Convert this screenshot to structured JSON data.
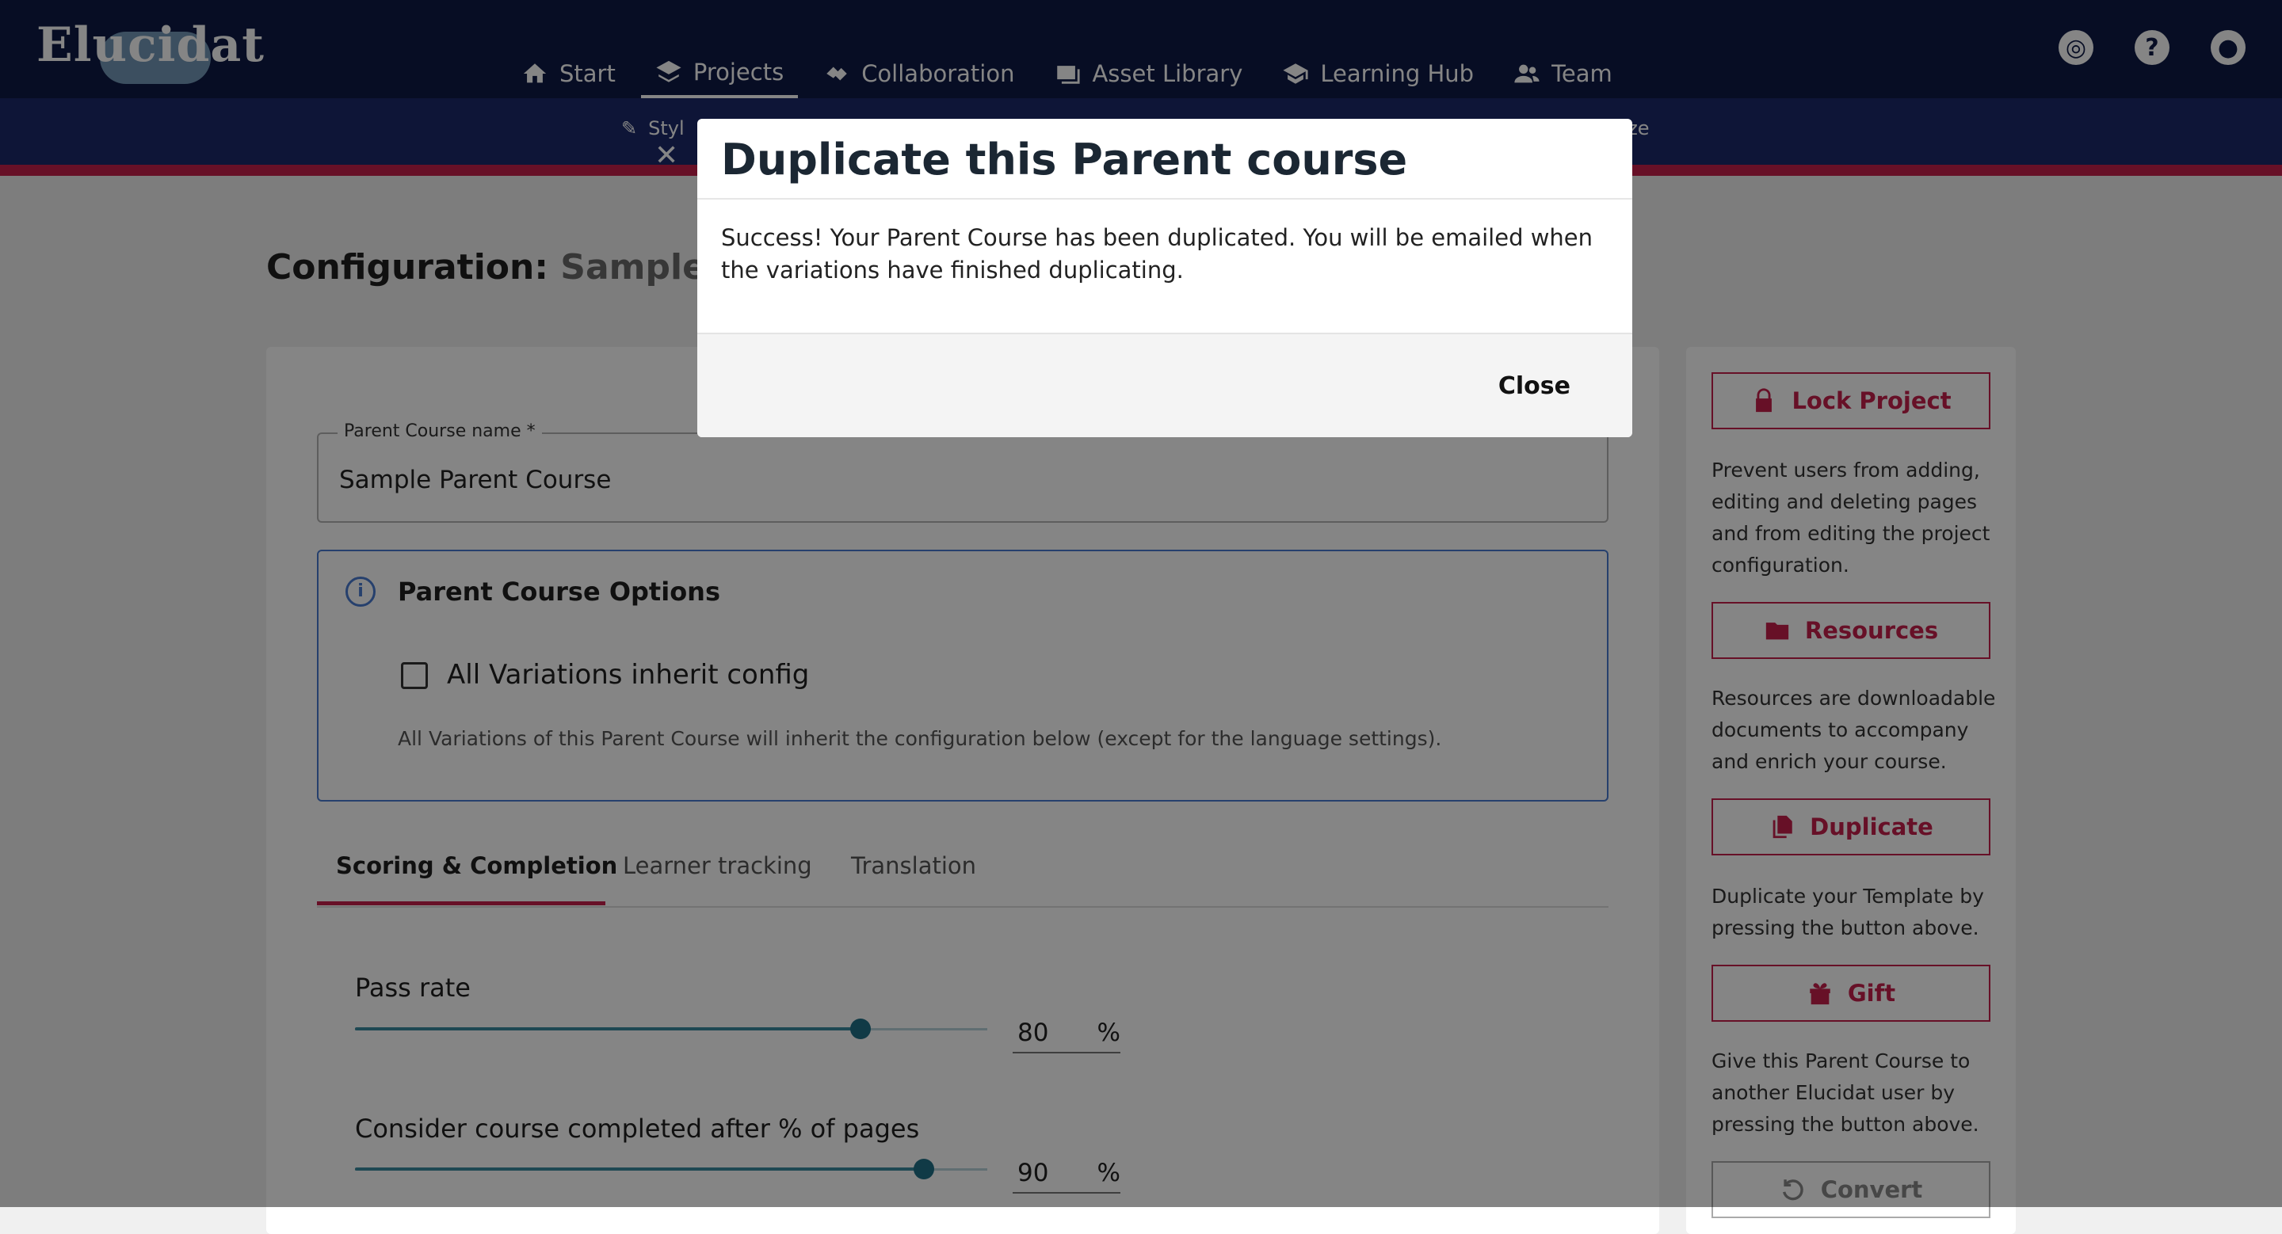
{
  "app": {
    "logo_text": "Elucidat"
  },
  "nav": {
    "items": [
      {
        "label": "Start",
        "icon": "home-icon"
      },
      {
        "label": "Projects",
        "icon": "layers-icon",
        "active": true
      },
      {
        "label": "Collaboration",
        "icon": "handshake-icon"
      },
      {
        "label": "Asset Library",
        "icon": "images-icon"
      },
      {
        "label": "Learning Hub",
        "icon": "graduation-cap-icon"
      },
      {
        "label": "Team",
        "icon": "people-icon"
      }
    ],
    "right_icons": [
      "globe-icon",
      "help-icon",
      "account-icon"
    ]
  },
  "subbar": {
    "left_label": "Styl",
    "right_label": "yze"
  },
  "page": {
    "title_prefix": "Configuration:",
    "title_name": "Sample Pa"
  },
  "form": {
    "name_label": "Parent Course name *",
    "name_value": "Sample Parent Course",
    "options_title": "Parent Course Options",
    "inherit_label": "All Variations inherit config",
    "inherit_checked": false,
    "inherit_desc": "All Variations of this Parent Course will inherit the configuration below (except for the language settings)."
  },
  "tabs": [
    {
      "label": "Scoring & Completion",
      "active": true
    },
    {
      "label": "Learner tracking"
    },
    {
      "label": "Translation"
    }
  ],
  "sliders": [
    {
      "label": "Pass rate",
      "value": "80",
      "unit": "%",
      "fraction": 0.8
    },
    {
      "label": "Consider course completed after % of pages",
      "value": "90",
      "unit": "%",
      "fraction": 0.9
    }
  ],
  "sidebar": {
    "lock_label": "Lock Project",
    "lock_desc": "Prevent users from adding, editing and deleting pages and from editing the project configuration.",
    "resources_label": "Resources",
    "resources_desc": "Resources are downloadable documents to accompany and enrich your course.",
    "duplicate_label": "Duplicate",
    "duplicate_desc": "Duplicate your Template by pressing the button above.",
    "gift_label": "Gift",
    "gift_desc": "Give this Parent Course to another Elucidat user by pressing the button above.",
    "convert_label": "Convert"
  },
  "modal": {
    "title": "Duplicate this Parent course",
    "body": "Success! Your Parent Course has been duplicated. You will be emailed when the variations have finished duplicating.",
    "close_label": "Close"
  },
  "colors": {
    "nav_bg": "#0e1a45",
    "accent": "#c51f4b",
    "info_blue": "#4a7bd1",
    "slider": "#1f6f87"
  }
}
